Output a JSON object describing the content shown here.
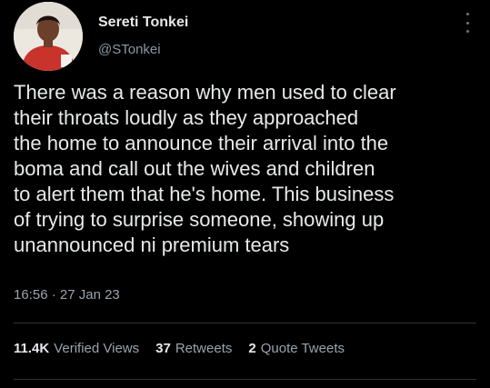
{
  "author": {
    "name": "Sereti Tonkei",
    "handle": "@STonkei"
  },
  "tweet": {
    "lines": [
      "There was a reason why men used to clear",
      "their throats loudly as they approached",
      "the home to announce their arrival into the",
      "boma and call out the wives and children",
      "to alert them that he's home. This business",
      "of trying to surprise someone, showing up",
      "unannounced ni premium tears"
    ],
    "time": "16:56",
    "separator": "·",
    "date": "27 Jan 23"
  },
  "stats": {
    "views_count": "11.4K",
    "views_label": "Verified Views",
    "retweets_count": "37",
    "retweets_label": "Retweets",
    "quotes_count": "2",
    "quotes_label": "Quote Tweets"
  },
  "icons": {
    "more": "more-vertical-icon"
  },
  "colors": {
    "background": "#000000",
    "text_primary": "#e7e9ea",
    "text_secondary": "#8b98a5",
    "divider": "#2f3336"
  }
}
